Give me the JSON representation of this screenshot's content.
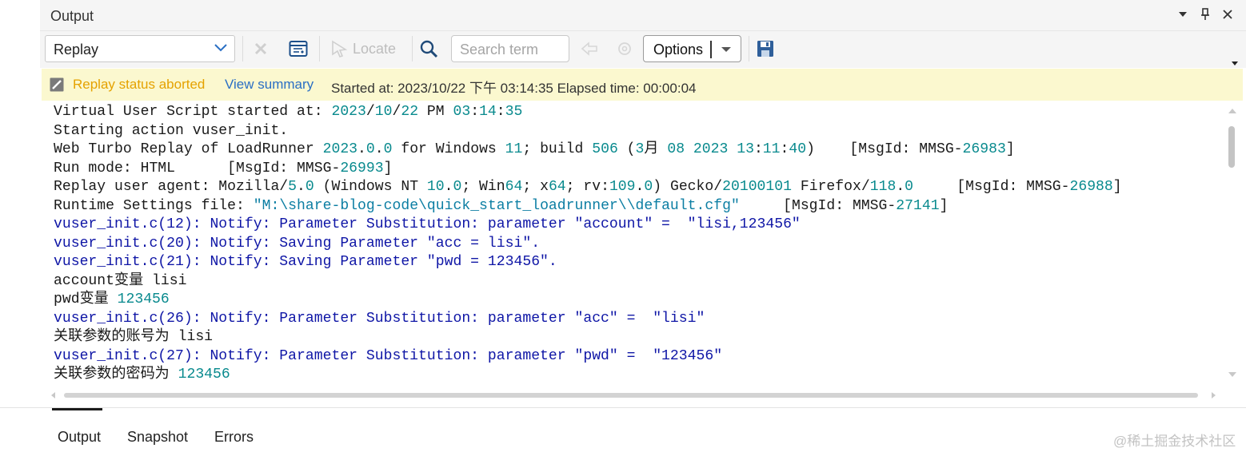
{
  "panel": {
    "title": "Output"
  },
  "toolbar": {
    "replay_select_value": "Replay",
    "locate_label": "Locate",
    "search_placeholder": "Search term",
    "options_label": "Options"
  },
  "status": {
    "state": "Replay status aborted",
    "view_summary": "View summary",
    "started": "Started at: 2023/10/22 下午 03:14:35 Elapsed time: 00:00:04"
  },
  "log": {
    "lines": [
      "Virtual User Script started at: 2023/10/22 PM 03:14:35",
      "Starting action vuser_init.",
      "Web Turbo Replay of LoadRunner 2023.0.0 for Windows 11; build 506 (3月 08 2023 13:11:40)    [MsgId: MMSG-26983]",
      "Run mode: HTML      [MsgId: MMSG-26993]",
      "Replay user agent: Mozilla/5.0 (Windows NT 10.0; Win64; x64; rv:109.0) Gecko/20100101 Firefox/118.0     [MsgId: MMSG-26988]",
      "Runtime Settings file: \"M:\\share-blog-code\\quick_start_loadrunner\\\\default.cfg\"     [MsgId: MMSG-27141]",
      "vuser_init.c(12): Notify: Parameter Substitution: parameter \"account\" =  \"lisi,123456\"",
      "vuser_init.c(20): Notify: Saving Parameter \"acc = lisi\".",
      "vuser_init.c(21): Notify: Saving Parameter \"pwd = 123456\".",
      "account变量 lisi",
      "pwd变量 123456",
      "vuser_init.c(26): Notify: Parameter Substitution: parameter \"acc\" =  \"lisi\"",
      "关联参数的账号为 lisi",
      "vuser_init.c(27): Notify: Parameter Substitution: parameter \"pwd\" =  \"123456\"",
      "关联参数的密码为 123456"
    ]
  },
  "tabs": [
    {
      "label": "Output"
    },
    {
      "label": "Snapshot"
    },
    {
      "label": "Errors"
    }
  ],
  "watermark": "@稀土掘金技术社区",
  "colors": {
    "status_bg": "#fbf8cf",
    "status_text": "#e5a200",
    "link": "#2a6fc4",
    "notify_text": "#0f16a6",
    "number_text": "#098a8e"
  }
}
